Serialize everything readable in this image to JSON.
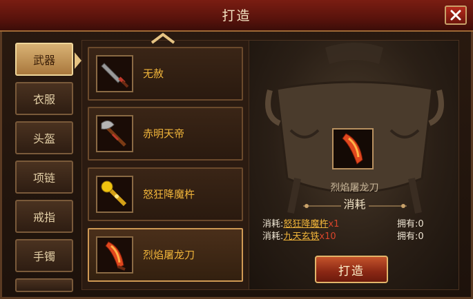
{
  "window": {
    "title": "打造"
  },
  "tabs": [
    {
      "label": "武器",
      "active": true
    },
    {
      "label": "衣服",
      "active": false
    },
    {
      "label": "头盔",
      "active": false
    },
    {
      "label": "项链",
      "active": false
    },
    {
      "label": "戒指",
      "active": false
    },
    {
      "label": "手镯",
      "active": false
    },
    {
      "label": "",
      "active": false
    }
  ],
  "items": [
    {
      "name": "无赦",
      "icon": "sword-icon",
      "selected": false
    },
    {
      "name": "赤明天帝",
      "icon": "axe-icon",
      "selected": false
    },
    {
      "name": "怒狂降魔杵",
      "icon": "pestle-icon",
      "selected": false
    },
    {
      "name": "烈焰屠龙刀",
      "icon": "flame-blade-icon",
      "selected": true
    }
  ],
  "craft": {
    "product_name": "烈焰屠龙刀",
    "consume_title": "消耗",
    "requirements": [
      {
        "label": "消耗:",
        "item": "怒狂降魔杵",
        "count": "x1",
        "own": "拥有:0"
      },
      {
        "label": "消耗:",
        "item": "九天玄铁",
        "count": "x10",
        "own": "拥有:0"
      }
    ],
    "button_label": "打造"
  },
  "colors": {
    "item_name": "#f0b43a",
    "count": "#d9452b",
    "title_bar": "#6e150c"
  }
}
